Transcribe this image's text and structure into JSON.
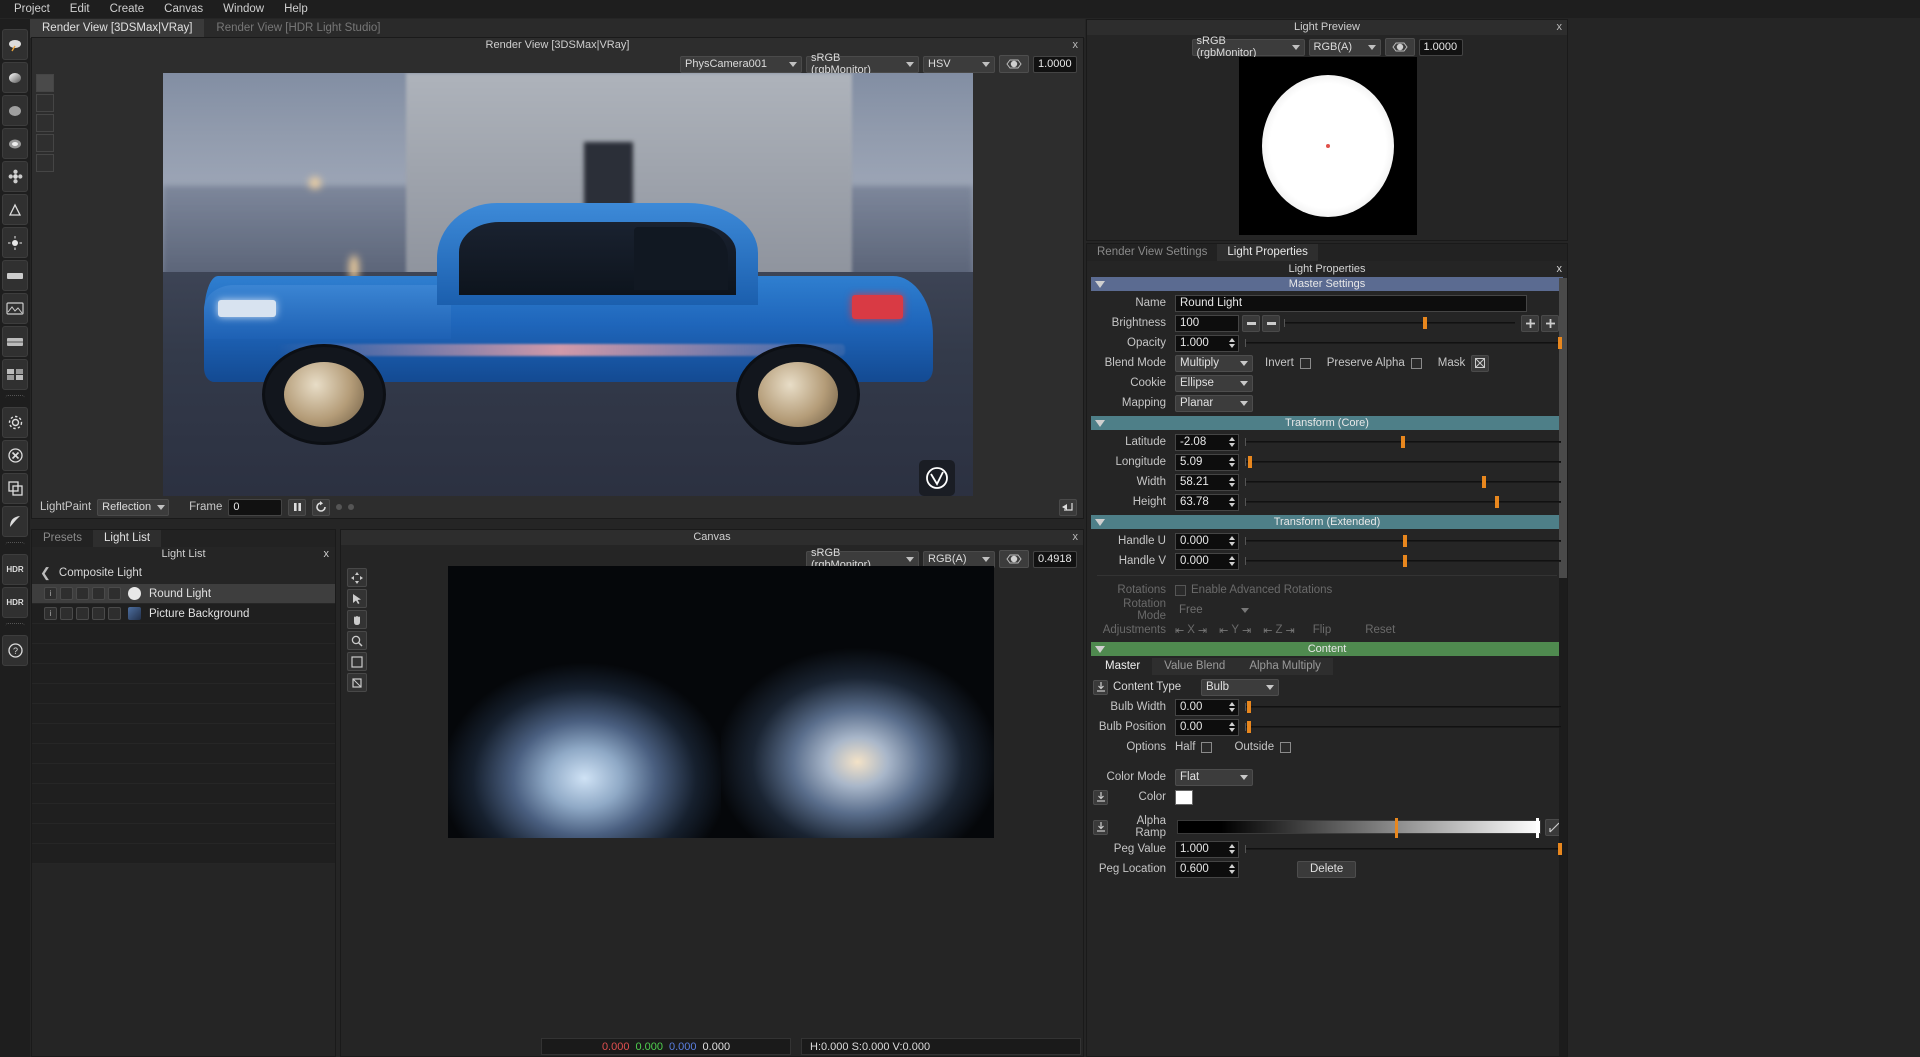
{
  "menu": {
    "items": [
      "Project",
      "Edit",
      "Create",
      "Canvas",
      "Window",
      "Help"
    ]
  },
  "top_tabs": [
    {
      "label": "Render View [3DSMax|VRay]",
      "active": true
    },
    {
      "label": "Render View [HDR Light Studio]",
      "active": false
    }
  ],
  "render_view": {
    "title": "Render View [3DSMax|VRay]",
    "close": "x",
    "camera": "PhysCamera001",
    "colorspace": "sRGB (rgbMonitor)",
    "channel": "HSV",
    "exposure": "1.0000",
    "lightpaint_label": "LightPaint",
    "lightpaint_mode": "Reflection",
    "frame_label": "Frame",
    "frame_value": "0"
  },
  "light_list": {
    "tabs": [
      {
        "label": "Presets",
        "active": false
      },
      {
        "label": "Light List",
        "active": true
      }
    ],
    "title": "Light List",
    "close": "x",
    "group": "Composite Light",
    "rows": [
      {
        "label": "Round Light",
        "icon": "round-light-icon",
        "selected": true
      },
      {
        "label": "Picture Background",
        "icon": "picture-icon",
        "selected": false
      }
    ]
  },
  "canvas": {
    "title": "Canvas",
    "close": "x",
    "colorspace": "sRGB (rgbMonitor)",
    "channel": "RGB(A)",
    "exposure": "0.4918",
    "value_r": "0.000",
    "value_g": "0.000",
    "value_b": "0.000",
    "value_a": "0.000",
    "hsv": "H:0.000 S:0.000 V:0.000"
  },
  "light_preview": {
    "title": "Light Preview",
    "close": "x",
    "colorspace": "sRGB (rgbMonitor)",
    "channel": "RGB(A)",
    "exposure": "1.0000"
  },
  "properties": {
    "tabs": [
      {
        "label": "Render View Settings",
        "active": false
      },
      {
        "label": "Light Properties",
        "active": true
      }
    ],
    "title": "Light Properties",
    "close": "x",
    "master_settings": {
      "header": "Master Settings",
      "name_label": "Name",
      "name_value": "Round Light",
      "brightness_label": "Brightness",
      "brightness_value": "100",
      "opacity_label": "Opacity",
      "opacity_value": "1.000",
      "blend_mode_label": "Blend Mode",
      "blend_mode_value": "Multiply",
      "invert_label": "Invert",
      "preserve_alpha_label": "Preserve Alpha",
      "mask_label": "Mask",
      "cookie_label": "Cookie",
      "cookie_value": "Ellipse",
      "mapping_label": "Mapping",
      "mapping_value": "Planar"
    },
    "transform_core": {
      "header": "Transform (Core)",
      "latitude_label": "Latitude",
      "latitude_value": "-2.08",
      "longitude_label": "Longitude",
      "longitude_value": "5.09",
      "width_label": "Width",
      "width_value": "58.21",
      "height_label": "Height",
      "height_value": "63.78"
    },
    "transform_extended": {
      "header": "Transform (Extended)",
      "handle_u_label": "Handle U",
      "handle_u_value": "0.000",
      "handle_v_label": "Handle V",
      "handle_v_value": "0.000",
      "rotations_label": "Rotations",
      "enable_advanced_rotations_label": "Enable Advanced Rotations",
      "rotation_mode_label": "Rotation Mode",
      "rotation_mode_value": "Free",
      "adjustments_label": "Adjustments",
      "axis_x": "X",
      "axis_y": "Y",
      "axis_z": "Z",
      "flip_label": "Flip",
      "reset_label": "Reset"
    },
    "content": {
      "header": "Content",
      "tabs": [
        {
          "label": "Master",
          "active": true
        },
        {
          "label": "Value Blend",
          "active": false
        },
        {
          "label": "Alpha Multiply",
          "active": false
        }
      ],
      "content_type_label": "Content Type",
      "content_type_value": "Bulb",
      "bulb_width_label": "Bulb Width",
      "bulb_width_value": "0.00",
      "bulb_position_label": "Bulb Position",
      "bulb_position_value": "0.00",
      "options_label": "Options",
      "half_label": "Half",
      "outside_label": "Outside",
      "color_mode_label": "Color Mode",
      "color_mode_value": "Flat",
      "color_label": "Color",
      "color_value": "#ffffff",
      "alpha_ramp_label": "Alpha Ramp",
      "peg_value_label": "Peg Value",
      "peg_value_value": "1.000",
      "peg_location_label": "Peg Location",
      "peg_location_value": "0.600",
      "delete_label": "Delete"
    }
  },
  "colors": {
    "accent_orange": "#e8871e",
    "section_blue": "#5b6b91",
    "section_teal": "#4e7f88",
    "section_green": "#4f8a4f",
    "panel_bg": "#252525"
  }
}
